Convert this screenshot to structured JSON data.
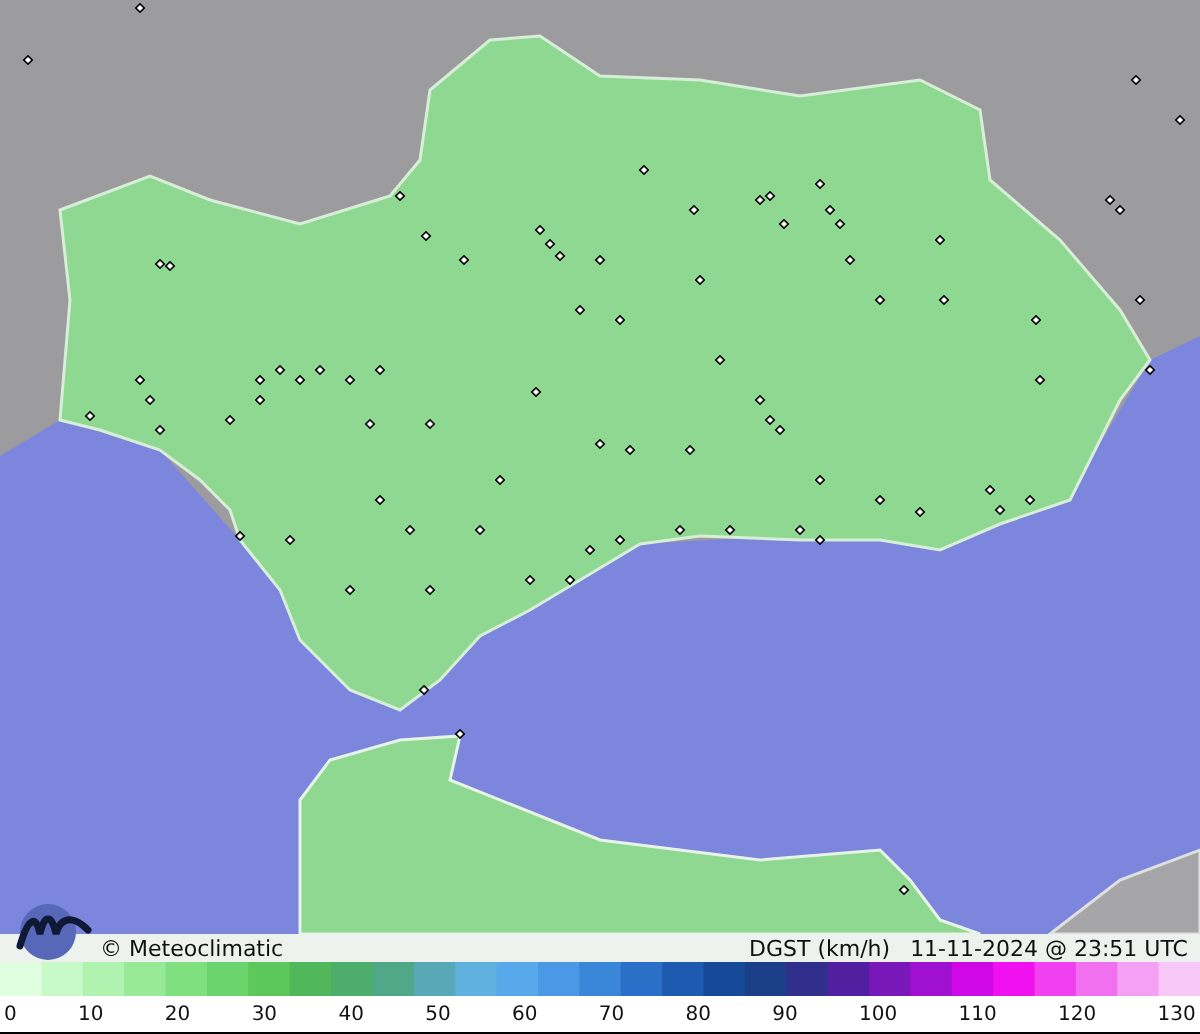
{
  "caption": {
    "credit": "© Meteoclimatic",
    "variable": "DGST (km/h)",
    "timestamp": "11-11-2024 @ 23:51 UTC"
  },
  "legend": {
    "ticks": [
      "0",
      "10",
      "20",
      "30",
      "40",
      "50",
      "60",
      "70",
      "80",
      "90",
      "100",
      "110",
      "120",
      "130"
    ]
  }
}
